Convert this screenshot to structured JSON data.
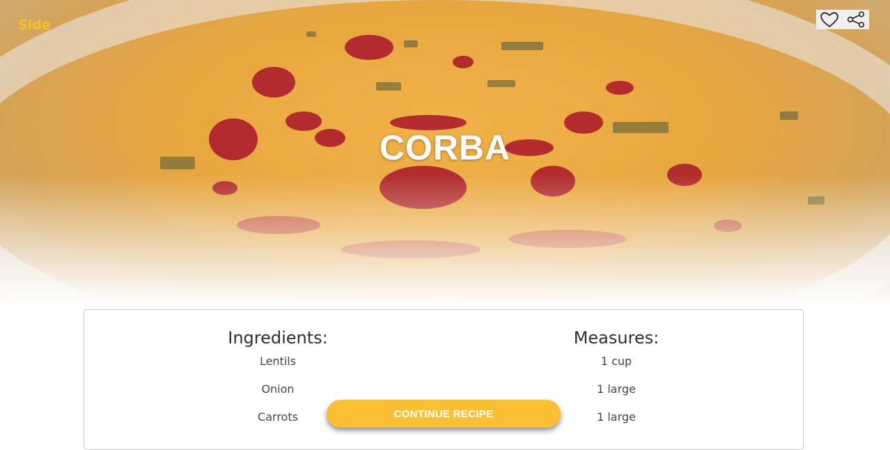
{
  "recipe": {
    "category": "Side",
    "title": "CORBA",
    "ingredients_heading": "Ingredients:",
    "measures_heading": "Measures:",
    "ingredients": [
      "Lentils",
      "Onion",
      "Carrots"
    ],
    "measures": [
      "1 cup",
      "1 large",
      "1 large"
    ]
  },
  "actions": {
    "favorite_icon": "heart-icon",
    "share_icon": "share-icon",
    "continue_label": "CONTINUE RECIPE"
  },
  "colors": {
    "accent": "#fbbf36",
    "category": "#f9bf2a"
  }
}
